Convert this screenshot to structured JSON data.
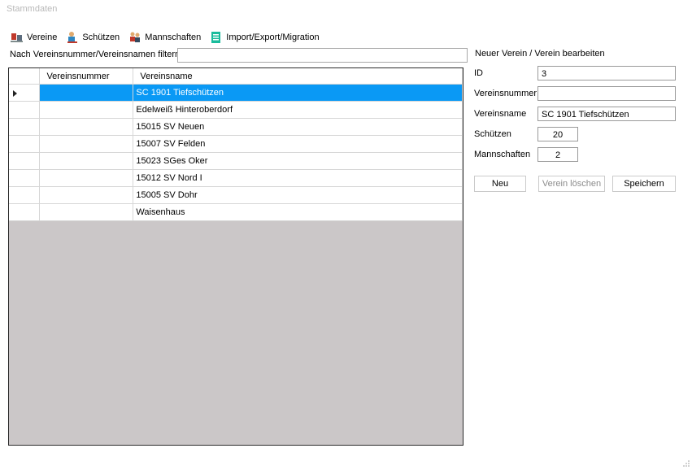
{
  "window": {
    "title": "Stammdaten"
  },
  "toolbar": {
    "items": [
      {
        "label": "Vereine",
        "icon": "vereine-icon"
      },
      {
        "label": "Schützen",
        "icon": "schuetzen-icon"
      },
      {
        "label": "Mannschaften",
        "icon": "mannschaften-icon"
      },
      {
        "label": "Import/Export/Migration",
        "icon": "import-export-icon"
      }
    ]
  },
  "filter": {
    "label": "Nach Vereinsnummer/Vereinsnamen filtern:",
    "value": ""
  },
  "grid": {
    "columns": [
      "Vereinsnummer",
      "Vereinsname"
    ],
    "rows": [
      {
        "nummer": "",
        "name": "SC 1901 Tiefschützen",
        "selected": true
      },
      {
        "nummer": "",
        "name": "Edelweiß Hinteroberdorf"
      },
      {
        "nummer": "",
        "name": "15015 SV Neuen"
      },
      {
        "nummer": "",
        "name": "15007 SV Felden"
      },
      {
        "nummer": "",
        "name": "15023 SGes Oker"
      },
      {
        "nummer": "",
        "name": "15012 SV Nord I"
      },
      {
        "nummer": "",
        "name": "15005 SV Dohr"
      },
      {
        "nummer": "",
        "name": "Waisenhaus"
      }
    ],
    "selection_color": "#0a99f5"
  },
  "editor": {
    "title": "Neuer Verein / Verein bearbeiten",
    "id_label": "ID",
    "id_value": "3",
    "nummer_label": "Vereinsnummer",
    "nummer_value": "",
    "name_label": "Vereinsname",
    "name_value": "SC 1901 Tiefschützen",
    "schuetzen_label": "Schützen",
    "schuetzen_value": "20",
    "mannschaften_label": "Mannschaften",
    "mannschaften_value": "2",
    "btn_new": "Neu",
    "btn_delete": "Verein löschen",
    "btn_save": "Speichern"
  }
}
